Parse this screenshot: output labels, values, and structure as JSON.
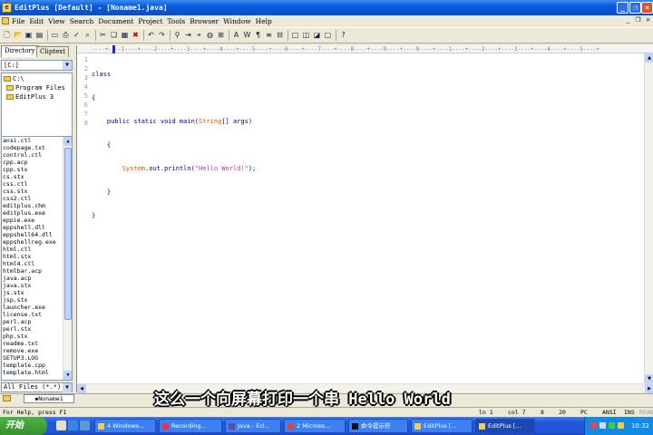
{
  "window": {
    "title": "EditPlus [Default] - [Noname1.java]",
    "app_icon": "editplus-icon"
  },
  "menu": [
    "File",
    "Edit",
    "View",
    "Search",
    "Document",
    "Project",
    "Tools",
    "Browser",
    "Window",
    "Help"
  ],
  "left_panel": {
    "tabs": [
      "Directory",
      "Cliptext"
    ],
    "drive": "[C:]",
    "tree": [
      "C:\\",
      "Program Files",
      "EditPlus 3"
    ],
    "files": [
      "ansi.ctl",
      "codepage.txt",
      "control.ctl",
      "cpp.acp",
      "cpp.stx",
      "cs.stx",
      "css.ctl",
      "css.stx",
      "css2.ctl",
      "editplus.chm",
      "editplus.exe",
      "eppie.exe",
      "eppshell.dll",
      "eppshell64.dll",
      "eppshellreg.exe",
      "html.ctl",
      "html.stx",
      "html4.ctl",
      "htmlbar.acp",
      "java.acp",
      "java.stx",
      "js.stx",
      "jsp.stx",
      "launcher.exe",
      "license.txt",
      "perl.acp",
      "perl.stx",
      "php.stx",
      "readme.txt",
      "remove.exe",
      "SETUP3.LOG",
      "template.cpp",
      "template.html"
    ],
    "filter": "All Files (*.*)"
  },
  "ruler": "----+----1----+----2----+----3----+----4----+----5----+----6----+----7----+----8----+----9----+----0----+----1----+----2----+----3----+----4----+----5----+",
  "editor": {
    "line_numbers": [
      "1",
      "2",
      "3",
      "4",
      "5",
      "6",
      "7",
      "8"
    ],
    "code": {
      "l1": "class",
      "l2": "{",
      "l3a": "    public static void main(",
      "l3b": "String",
      "l3c": "[] args)",
      "l4": "    {",
      "l5a": "        ",
      "l5b": "System",
      "l5c": ".out.println(",
      "l5d": "\"Hello World!\"",
      "l5e": ");",
      "l6": "    }",
      "l7": "}",
      "l8": ""
    }
  },
  "doc_tab": "Noname1",
  "caption": "这么一个向屏幕打印一个串 Hello World",
  "status": {
    "help": "For Help, press F1",
    "ln": "ln 1",
    "col": "col 7",
    "n1": "8",
    "n2": "20",
    "mode": "PC",
    "enc": "ANSI",
    "ins": "INS",
    "read": "READ"
  },
  "taskbar": {
    "start": "开始",
    "tasks": [
      "4 Windows...",
      "Recording...",
      "Java - Ecl...",
      "2 Microso...",
      "命令提示符",
      "EditPlus [...",
      "EditPlus [..."
    ],
    "clock": "10:32"
  },
  "colors": {
    "keyword": "#00008b",
    "string": "#cc3399",
    "type": "#d05a00",
    "titlebar": "#0a5ad8"
  }
}
